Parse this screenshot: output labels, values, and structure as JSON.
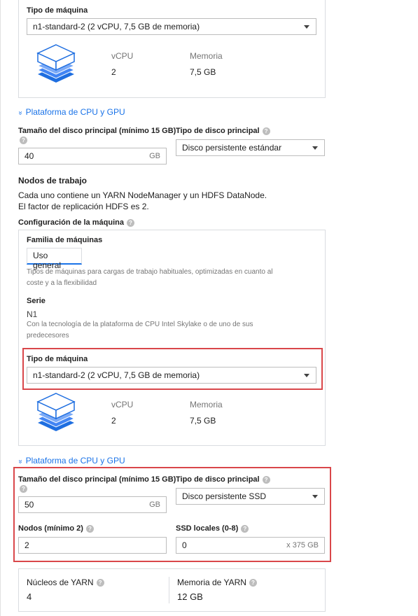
{
  "top_card": {
    "machine_type_label": "Tipo de máquina",
    "machine_type_value": "n1-standard-2 (2 vCPU, 7,5 GB de memoria)",
    "vcpu_label": "vCPU",
    "vcpu_value": "2",
    "memory_label": "Memoria",
    "memory_value": "7,5 GB"
  },
  "master_cpu_gpu_link": "Plataforma de CPU y GPU",
  "master_disk": {
    "size_label": "Tamaño del disco principal (mínimo 15 GB)",
    "size_value": "40",
    "size_suffix": "GB",
    "type_label": "Tipo de disco principal",
    "type_value": "Disco persistente estándar"
  },
  "workers": {
    "heading": "Nodos de trabajo",
    "desc_line1": "Cada uno contiene un YARN NodeManager y un HDFS DataNode.",
    "desc_line2": "El factor de replicación HDFS es 2.",
    "machine_config_label": "Configuración de la máquina",
    "family_label": "Familia de máquinas",
    "family_tab": "Uso general",
    "family_desc_line1": "Tipos de máquinas para cargas de trabajo habituales, optimizadas en cuanto al",
    "family_desc_line2": "coste y a la flexibilidad",
    "series_label": "Serie",
    "series_value": "N1",
    "series_desc_line1": "Con la tecnología de la plataforma de CPU Intel Skylake o de uno de sus",
    "series_desc_line2": "predecesores",
    "machine_type_label": "Tipo de máquina",
    "machine_type_value": "n1-standard-2 (2 vCPU, 7,5 GB de memoria)",
    "vcpu_label": "vCPU",
    "vcpu_value": "2",
    "memory_label": "Memoria",
    "memory_value": "7,5 GB",
    "cpu_gpu_link": "Plataforma de CPU y GPU",
    "disk_size_label": "Tamaño del disco principal (mínimo 15 GB)",
    "disk_size_value": "50",
    "disk_size_suffix": "GB",
    "disk_type_label": "Tipo de disco principal",
    "disk_type_value": "Disco persistente SSD",
    "nodes_label": "Nodos (mínimo 2)",
    "nodes_value": "2",
    "ssd_label": "SSD locales (0-8)",
    "ssd_value": "0",
    "ssd_suffix": "x 375 GB"
  },
  "yarn": {
    "cores_label": "Núcleos de YARN",
    "cores_value": "4",
    "memory_label": "Memoria de YARN",
    "memory_value": "12 GB"
  },
  "colors": {
    "accent": "#1a73e8",
    "highlight": "#d9474a",
    "chip_blue": "#4285f4"
  },
  "icons": {
    "help": "?",
    "chevron": "»"
  }
}
